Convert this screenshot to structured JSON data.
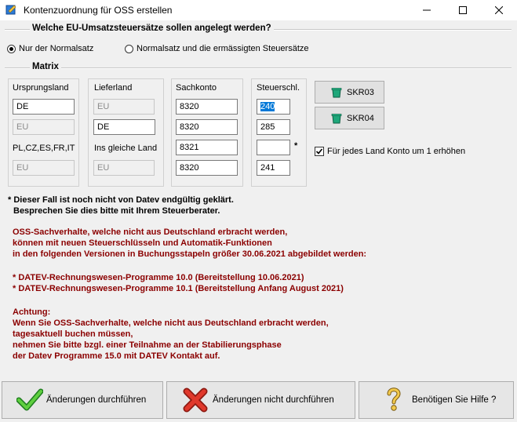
{
  "window": {
    "title": "Kontenzuordnung für OSS erstellen"
  },
  "question": {
    "legend": "Welche EU-Umsatzsteuersätze sollen angelegt werden?",
    "options": [
      {
        "label": "Nur der Normalsatz",
        "selected": true
      },
      {
        "label": "Normalsatz und die ermässigten Steuersätze",
        "selected": false
      }
    ]
  },
  "matrix": {
    "legend": "Matrix",
    "headers": {
      "ursprungsland": "Ursprungsland",
      "lieferland": "Lieferland",
      "sachkonto": "Sachkonto",
      "steuerschl": "Steuerschl."
    },
    "rows": [
      {
        "ursprungsland": "DE",
        "lieferland": "EU",
        "sachkonto": "8320",
        "steuerschl": "240"
      },
      {
        "ursprungsland": "EU",
        "lieferland": "DE",
        "sachkonto": "8320",
        "steuerschl": "285"
      },
      {
        "ursprungsland": "PL,CZ,ES,FR,IT",
        "lieferland": "Ins gleiche Land",
        "sachkonto": "8321",
        "steuerschl": ""
      },
      {
        "ursprungsland": "EU",
        "lieferland": "EU",
        "sachkonto": "8320",
        "steuerschl": "241"
      }
    ],
    "asterisk": "*"
  },
  "buttons": {
    "skr03": "SKR03",
    "skr04": "SKR04"
  },
  "checkbox": {
    "label": "Für jedes Land Konto um 1 erhöhen",
    "checked": true
  },
  "note": {
    "line1": "* Dieser Fall ist noch nicht von Datev endgültig geklärt.",
    "line2": "Besprechen Sie dies bitte mit Ihrem Steuerberater."
  },
  "info": {
    "p1": [
      "OSS-Sachverhalte, welche nicht aus Deutschland erbracht werden,",
      "können mit neuen Steuerschlüsseln und Automatik-Funktionen",
      "in den folgenden Versionen in Buchungsstapeln größer 30.06.2021 abgebildet werden:"
    ],
    "p2": [
      "* DATEV-Rechnungswesen-Programme 10.0 (Bereitstellung 10.06.2021)",
      "* DATEV-Rechnungswesen-Programme 10.1 (Bereitstellung Anfang August 2021)"
    ],
    "p3": [
      "Achtung:",
      "Wenn Sie OSS-Sachverhalte, welche nicht aus Deutschland erbracht werden,",
      "tagesaktuell buchen müssen,",
      "nehmen Sie bitte bzgl. einer Teilnahme an der Stabilierungsphase",
      "der Datev Programme 15.0 mit DATEV Kontakt auf."
    ]
  },
  "footer": {
    "apply": "Änderungen durchführen",
    "cancel": "Änderungen nicht durchführen",
    "help": "Benötigen Sie Hilfe ?"
  },
  "colors": {
    "red_text": "#8b0000",
    "selection": "#0078d7",
    "check_green": "#2e9e2e",
    "cross_red": "#d52b1e"
  },
  "icons": [
    "app-icon",
    "minimize-icon",
    "maximize-icon",
    "close-icon",
    "bucket-icon",
    "checkmark-icon",
    "cross-icon",
    "question-figure-icon"
  ]
}
